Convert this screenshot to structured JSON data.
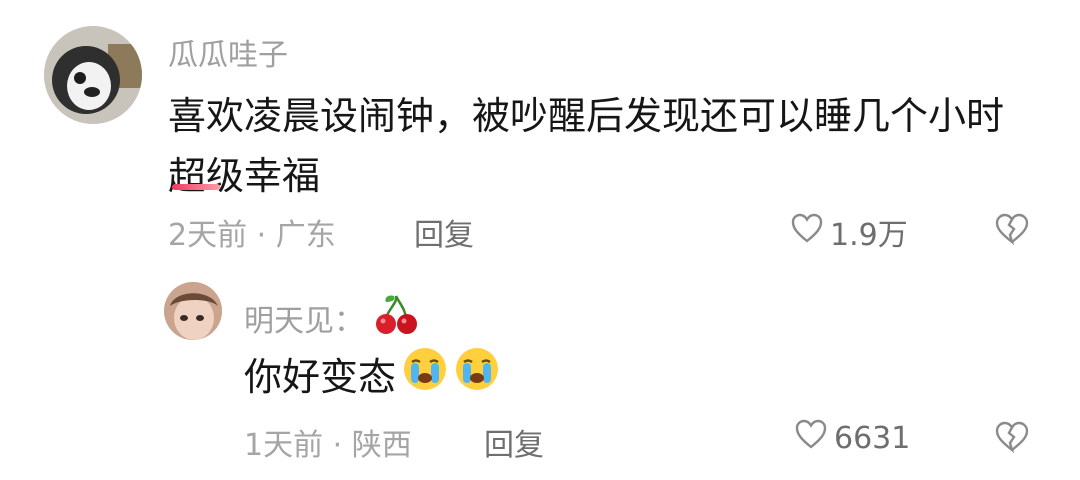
{
  "comments": [
    {
      "username": "瓜瓜哇子",
      "content": "喜欢凌晨设闹钟，被吵醒后发现还可以睡几个小时超级幸福",
      "time": "2天前",
      "location": "广东",
      "reply_label": "回复",
      "likes": "1.9万"
    }
  ],
  "replies": [
    {
      "username": "明天见：",
      "content": "你好变态",
      "time": "1天前",
      "location": "陕西",
      "reply_label": "回复",
      "likes": "6631"
    }
  ],
  "icons": {
    "heart": "heart-outline-icon",
    "dislike": "broken-heart-icon",
    "badge": "cherry-icon",
    "emoji": "crying-face-emoji"
  },
  "colors": {
    "accent_underline": "#ee3b62",
    "muted_text": "#a5a5a5",
    "main_text": "#161616"
  }
}
